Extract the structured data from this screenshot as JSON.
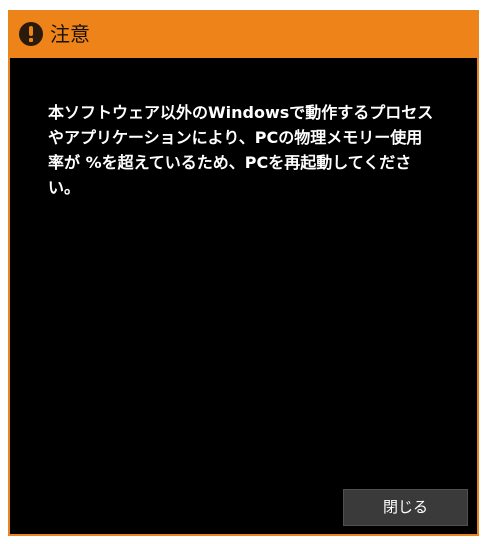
{
  "dialog": {
    "title": "注意",
    "message": "本ソフトウェア以外のWindowsで動作するプロセスやアプリケーションにより、PCの物理メモリー使用率が %を超えているため、PCを再起動してください。",
    "close_label": "閉じる"
  },
  "colors": {
    "title_bar": "#ee8419",
    "background": "#000000",
    "button": "#3a3a3a"
  },
  "icons": {
    "title_icon": "warning-icon"
  }
}
